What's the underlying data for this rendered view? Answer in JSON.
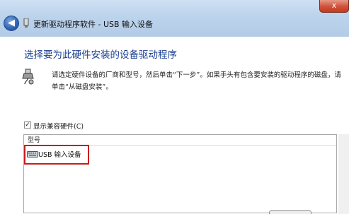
{
  "window": {
    "title": "更新驱动程序软件 - USB 输入设备",
    "close_symbol": "x",
    "back_symbol": "◀"
  },
  "main": {
    "heading": "选择要为此硬件安装的设备驱动程序",
    "instruction": "请选定硬件设备的厂商和型号，然后单击“下一步”。如果手头有包含要安装的驱动程序的磁盘，请单击“从磁盘安装”。"
  },
  "compatible_checkbox": {
    "checked": true,
    "mark": "✓",
    "label": "显示兼容硬件(C)"
  },
  "model_list": {
    "column_header": "型号",
    "items": [
      {
        "label": "USB 输入设备",
        "icon": "keyboard-icon",
        "highlighted": true
      }
    ]
  },
  "colors": {
    "heading": "#1a3f8f",
    "highlight": "#c81b1b",
    "titlebar": "#bcd3ec"
  }
}
